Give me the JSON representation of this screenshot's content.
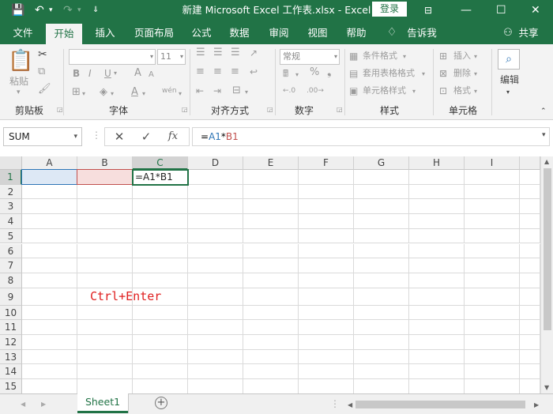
{
  "titlebar": {
    "title": "新建 Microsoft Excel 工作表.xlsx  -  Excel",
    "login": "登录"
  },
  "menu": {
    "tabs": [
      "文件",
      "开始",
      "插入",
      "页面布局",
      "公式",
      "数据",
      "审阅",
      "视图",
      "帮助",
      "告诉我",
      "共享"
    ],
    "active": "开始"
  },
  "ribbon": {
    "clipboard": {
      "paste": "粘贴",
      "label": "剪贴板"
    },
    "font": {
      "size": "11",
      "bold": "B",
      "italic": "I",
      "underline": "U",
      "font_color": "A",
      "grow": "A",
      "shrink": "A",
      "phonetic": "wén",
      "label": "字体"
    },
    "alignment": {
      "label": "对齐方式"
    },
    "number": {
      "format": "常规",
      "label": "数字"
    },
    "styles": {
      "conditional": "条件格式",
      "table": "套用表格格式",
      "cell_styles": "单元格样式",
      "label": "样式"
    },
    "cells": {
      "insert": "插入",
      "delete": "删除",
      "format": "格式",
      "label": "单元格"
    },
    "editing": {
      "label": "编辑"
    }
  },
  "formula_bar": {
    "name_box": "SUM",
    "formula_ref1": "A1",
    "formula_op": "*",
    "formula_ref2": "B1"
  },
  "grid": {
    "columns": [
      "A",
      "B",
      "C",
      "D",
      "E",
      "F",
      "G",
      "H",
      "I"
    ],
    "rows": [
      "1",
      "2",
      "3",
      "4",
      "5",
      "6",
      "7",
      "8",
      "9",
      "10",
      "11",
      "12",
      "13",
      "14",
      "15"
    ],
    "selected_column": "C",
    "selected_row": "1",
    "active_cell_text": "=A1*B1",
    "ref_colors": {
      "A1": "#2e75b6",
      "B1": "#c0504d"
    }
  },
  "annotation": "Ctrl+Enter",
  "sheets": {
    "tabs": [
      "Sheet1"
    ],
    "active": "Sheet1"
  },
  "colors": {
    "accent": "#217346"
  }
}
